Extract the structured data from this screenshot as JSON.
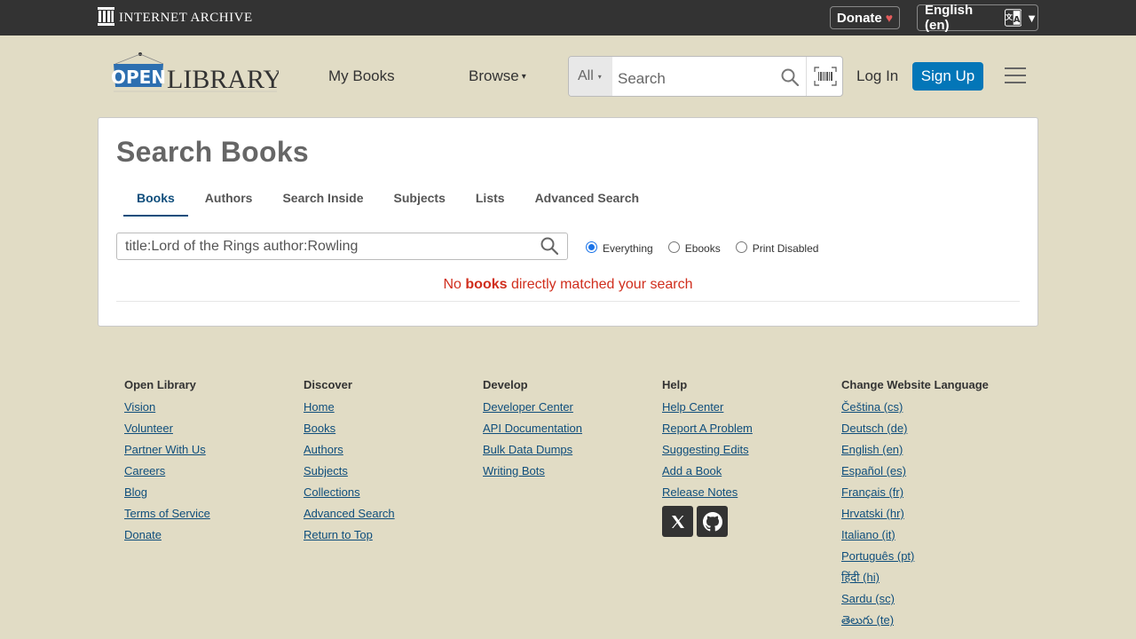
{
  "ia_bar": {
    "brand": "INTERNET ARCHIVE",
    "donate_label": "Donate",
    "donate_heart": "♥",
    "language_label": "English (en)",
    "language_caret": "▼"
  },
  "header": {
    "logo_icon": "open-library-logo",
    "nav": {
      "my_books": "My Books",
      "browse": "Browse",
      "browse_caret": "▾"
    },
    "search": {
      "scope": "All",
      "scope_caret": "▾",
      "placeholder": "Search"
    },
    "login": "Log In",
    "signup": "Sign Up"
  },
  "main": {
    "title": "Search Books",
    "tabs": [
      {
        "label": "Books",
        "active": true
      },
      {
        "label": "Authors",
        "active": false
      },
      {
        "label": "Search Inside",
        "active": false
      },
      {
        "label": "Subjects",
        "active": false
      },
      {
        "label": "Lists",
        "active": false
      },
      {
        "label": "Advanced Search",
        "active": false
      }
    ],
    "query": "title:Lord of the Rings author:Rowling",
    "filters": [
      {
        "label": "Everything",
        "checked": true
      },
      {
        "label": "Ebooks",
        "checked": false
      },
      {
        "label": "Print Disabled",
        "checked": false
      }
    ],
    "no_results": {
      "prefix": "No ",
      "emphasis": "books",
      "suffix": " directly matched your search"
    }
  },
  "footer": {
    "open_library": {
      "heading": "Open Library",
      "links": [
        "Vision",
        "Volunteer",
        "Partner With Us",
        "Careers",
        "Blog",
        "Terms of Service",
        "Donate"
      ]
    },
    "discover": {
      "heading": "Discover",
      "links": [
        "Home",
        "Books",
        "Authors",
        "Subjects",
        "Collections",
        "Advanced Search",
        "Return to Top"
      ]
    },
    "develop": {
      "heading": "Develop",
      "links": [
        "Developer Center",
        "API Documentation",
        "Bulk Data Dumps",
        "Writing Bots"
      ]
    },
    "help": {
      "heading": "Help",
      "links": [
        "Help Center",
        "Report A Problem",
        "Suggesting Edits",
        "Add a Book",
        "Release Notes"
      ],
      "social": [
        "x-icon",
        "github-icon"
      ]
    },
    "language": {
      "heading": "Change Website Language",
      "links": [
        "Čeština (cs)",
        "Deutsch (de)",
        "English (en)",
        "Español (es)",
        "Français (fr)",
        "Hrvatski (hr)",
        "Italiano (it)",
        "Português (pt)",
        "हिंदी (hi)",
        "Sardu (sc)",
        "తెలుగు (te)"
      ]
    }
  },
  "colors": {
    "background": "#e1dcc5",
    "top_bar": "#333333",
    "accent": "#0376b8",
    "link": "#0f4e7c",
    "error": "#d02e1d"
  }
}
